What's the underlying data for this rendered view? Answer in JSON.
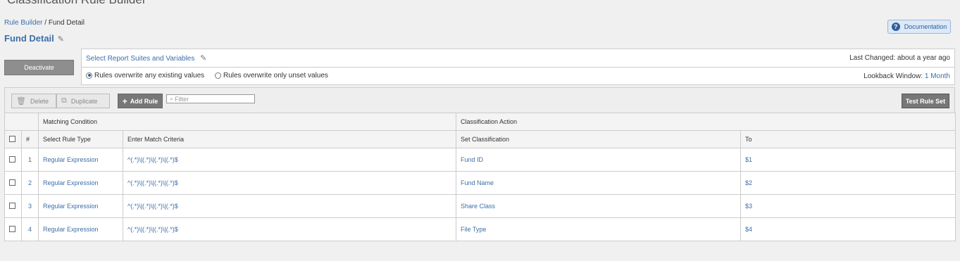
{
  "app_title": "Classification Rule Builder",
  "breadcrumb": {
    "root": "Rule Builder",
    "separator": " / ",
    "current": "Fund Detail"
  },
  "page_title": "Fund Detail",
  "documentation_label": "Documentation",
  "deactivate_label": "Deactivate",
  "config": {
    "select_suites_label": "Select Report Suites and Variables",
    "last_changed_label": "Last Changed: about a year ago",
    "radio_overwrite_any": "Rules overwrite any existing values",
    "radio_overwrite_unset": "Rules overwrite only unset values",
    "lookback_label": "Lookback Window: ",
    "lookback_value": "1 Month"
  },
  "toolbar": {
    "delete_label": "Delete",
    "duplicate_label": "Duplicate",
    "add_rule_label": "Add Rule",
    "filter_placeholder": "Filter",
    "test_label": "Test Rule Set"
  },
  "table": {
    "group_headers": [
      "Matching Condition",
      "Classification Action"
    ],
    "columns": [
      "#",
      "Select Rule Type",
      "Enter Match Criteria",
      "Set Classification",
      "To"
    ],
    "rows": [
      {
        "num": "1",
        "type": "Regular Expression",
        "criteria": "^(.*)\\|(.*)\\|(.*)\\|(.*)$",
        "classification": "Fund ID",
        "to": "$1"
      },
      {
        "num": "2",
        "type": "Regular Expression",
        "criteria": "^(.*)\\|(.*)\\|(.*)\\|(.*)$",
        "classification": "Fund Name",
        "to": "$2"
      },
      {
        "num": "3",
        "type": "Regular Expression",
        "criteria": "^(.*)\\|(.*)\\|(.*)\\|(.*)$",
        "classification": "Share Class",
        "to": "$3"
      },
      {
        "num": "4",
        "type": "Regular Expression",
        "criteria": "^(.*)\\|(.*)\\|(.*)\\|(.*)$",
        "classification": "File Type",
        "to": "$4"
      }
    ]
  }
}
